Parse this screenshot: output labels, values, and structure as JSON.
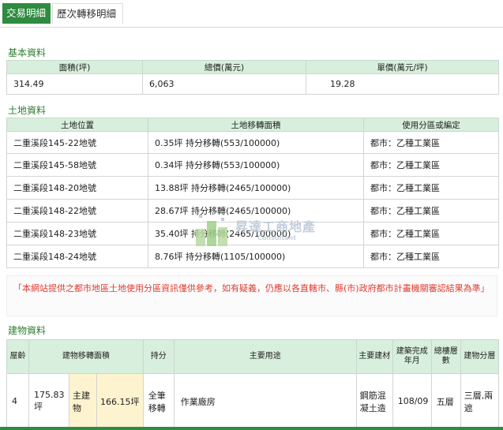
{
  "tabs": [
    {
      "label": "交易明細",
      "active": true
    },
    {
      "label": "歷次轉移明細",
      "active": false
    }
  ],
  "basic": {
    "title": "基本資料",
    "headers": [
      "面積(坪)",
      "總價(萬元)",
      "單價(萬元/坪)"
    ],
    "values": [
      "314.49",
      "6,063",
      "19.28"
    ]
  },
  "land": {
    "title": "土地資料",
    "headers": [
      "土地位置",
      "土地移轉面積",
      "使用分區或編定"
    ],
    "rows": [
      {
        "location": "二重溪段145-22地號",
        "area": "0.35坪 持分移轉(553/100000)",
        "zone": "都市：乙種工業區"
      },
      {
        "location": "二重溪段145-58地號",
        "area": "0.34坪 持分移轉(553/100000)",
        "zone": "都市：乙種工業區"
      },
      {
        "location": "二重溪段148-20地號",
        "area": "13.88坪 持分移轉(2465/100000)",
        "zone": "都市：乙種工業區"
      },
      {
        "location": "二重溪段148-22地號",
        "area": "28.67坪 持分移轉(2465/100000)",
        "zone": "都市：乙種工業區"
      },
      {
        "location": "二重溪段148-23地號",
        "area": "35.40坪 持分移轉(2465/100000)",
        "zone": "都市：乙種工業區"
      },
      {
        "location": "二重溪段148-24地號",
        "area": "8.76坪 持分移轉(1105/100000)",
        "zone": "都市：乙種工業區"
      }
    ]
  },
  "notice": "「本網站提供之都市地區土地使用分區資訊僅供參考，如有疑義，仍應以各直轄市、縣(市)政府都市計畫機關審認結果為準」",
  "building": {
    "title": "建物資料",
    "headers": {
      "floor": "屋齡",
      "transfer_area": "建物移轉面積",
      "share": "持分",
      "usage": "主要用途",
      "material": "主要建材",
      "completed": "建築完成年月",
      "total_floors": "總樓層數",
      "layout": "建物分層"
    },
    "row": {
      "floor": "4",
      "transfer_area": "175.83坪",
      "main_label": "主建物",
      "main_area": "166.15坪",
      "share": "全筆移轉",
      "usage": "作業廠房",
      "material": "鋼筋混凝土造",
      "completed": "108/09",
      "total_floors": "五層",
      "layout": "三層,兩遮"
    }
  },
  "watermark": {
    "title": "昇達工商地產",
    "sub": "Consultant"
  },
  "colors": {
    "accent": "#2e8b3f",
    "header_bg": "#d7efdc",
    "notice": "#e03c31",
    "section_title": "#2e7d32"
  }
}
